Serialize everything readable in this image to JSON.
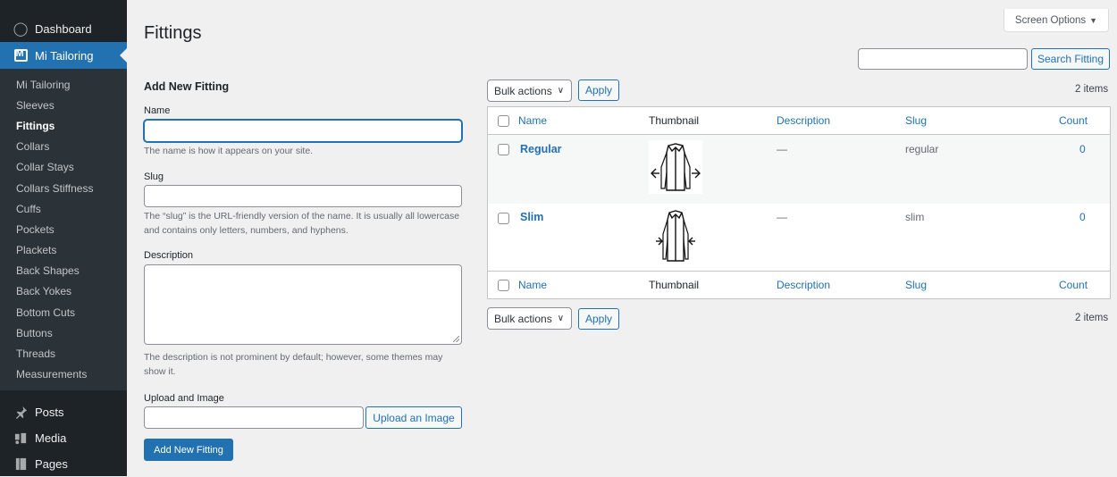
{
  "sidebar": {
    "dashboard": "Dashboard",
    "current_menu": "Mi Tailoring",
    "submenu": [
      "Mi Tailoring",
      "Sleeves",
      "Fittings",
      "Collars",
      "Collar Stays",
      "Collars Stiffness",
      "Cuffs",
      "Pockets",
      "Plackets",
      "Back Shapes",
      "Back Yokes",
      "Bottom Cuts",
      "Buttons",
      "Threads",
      "Measurements"
    ],
    "active_submenu": "Fittings",
    "posts": "Posts",
    "media": "Media",
    "pages": "Pages"
  },
  "header": {
    "title": "Fittings",
    "screen_options": "Screen Options",
    "search_button": "Search Fitting"
  },
  "form": {
    "heading": "Add New Fitting",
    "name_label": "Name",
    "name_help": "The name is how it appears on your site.",
    "slug_label": "Slug",
    "slug_help": "The “slug” is the URL-friendly version of the name. It is usually all lowercase and contains only letters, numbers, and hyphens.",
    "description_label": "Description",
    "description_help": "The description is not prominent by default; however, some themes may show it.",
    "upload_label": "Upload and Image",
    "upload_button": "Upload an Image",
    "submit": "Add New Fitting"
  },
  "table": {
    "bulk_actions": "Bulk actions",
    "apply": "Apply",
    "items_count": "2 items",
    "columns": [
      "Name",
      "Thumbnail",
      "Description",
      "Slug",
      "Count"
    ],
    "rows": [
      {
        "name": "Regular",
        "description": "—",
        "slug": "regular",
        "count": "0",
        "thumbnail": "regular-fit-shirt-icon"
      },
      {
        "name": "Slim",
        "description": "—",
        "slug": "slim",
        "count": "0",
        "thumbnail": "slim-fit-shirt-icon"
      }
    ]
  },
  "colors": {
    "sidebar_bg": "#1d2327",
    "accent": "#2271b1",
    "page_bg": "#f0f0f1"
  }
}
